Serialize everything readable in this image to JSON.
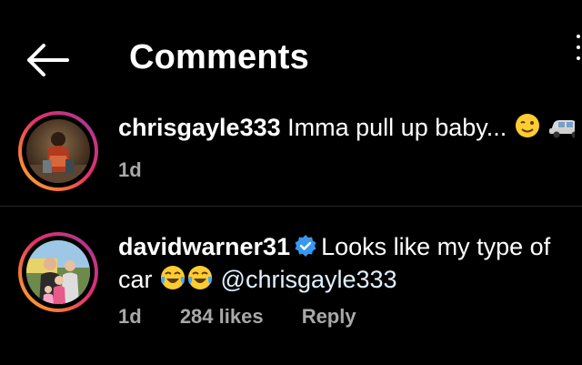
{
  "header": {
    "title": "Comments",
    "back_icon": "arrow-left-icon"
  },
  "comments": [
    {
      "username": "chrisgayle333",
      "text": "Imma pull up baby...",
      "emojis": [
        "wink-face-icon",
        "car-icon"
      ],
      "time": "1d",
      "avatar": "profile-photo"
    },
    {
      "username": "davidwarner31",
      "verified": true,
      "text": "Looks like my type of car",
      "emojis": [
        "tears-of-joy-icon",
        "tears-of-joy-icon"
      ],
      "mention": "@chrisgayle333",
      "time": "1d",
      "likes": "284 likes",
      "reply": "Reply",
      "avatar": "profile-photo"
    }
  ],
  "colors": {
    "background": "#000000",
    "text": "#ffffff",
    "meta": "#a8a8a8",
    "verified": "#3897f0",
    "mention": "#e0f1ff"
  }
}
